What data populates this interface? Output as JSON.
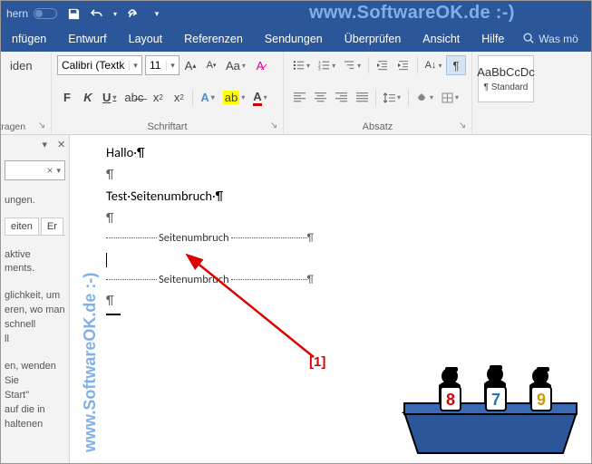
{
  "watermark": "www.SoftwareOK.de :-)",
  "titlebar": {
    "label_fragment": "hern"
  },
  "tabs": {
    "t1": "nfügen",
    "t2": "Entwurf",
    "t3": "Layout",
    "t4": "Referenzen",
    "t5": "Sendungen",
    "t6": "Überprüfen",
    "t7": "Ansicht",
    "t8": "Hilfe",
    "tellme": "Was mö"
  },
  "ribbon": {
    "clipboard": {
      "btn": "iden",
      "transfer": "ertragen"
    },
    "font": {
      "name": "Calibri (Textk",
      "size": "11",
      "bold": "F",
      "italic": "K",
      "underline": "U",
      "group_label": "Schriftart"
    },
    "para": {
      "group_label": "Absatz"
    },
    "styles": {
      "preview": "AaBbCcDc",
      "name": "¶ Standard"
    }
  },
  "nav": {
    "line1": "ungen.",
    "tab1": "eiten",
    "tab2": "Er",
    "p1": "aktive",
    "p2": "ments.",
    "p3": "glichkeit, um",
    "p4": "eren, wo man",
    "p5": "schnell",
    "p6": "ll",
    "p7": "en, wenden Sie",
    "p8": "Start\"",
    "p9": "auf die in",
    "p10": "haltenen"
  },
  "doc": {
    "l1": "Hallo·¶",
    "l2": "¶",
    "l3": "Test·Seitenumbruch·¶",
    "l4": "¶",
    "pb": "Seitenumbruch",
    "pil": "¶"
  },
  "annotation": {
    "one": "[1]"
  },
  "judges": {
    "s1": "8",
    "s2": "7",
    "s3": "9"
  }
}
